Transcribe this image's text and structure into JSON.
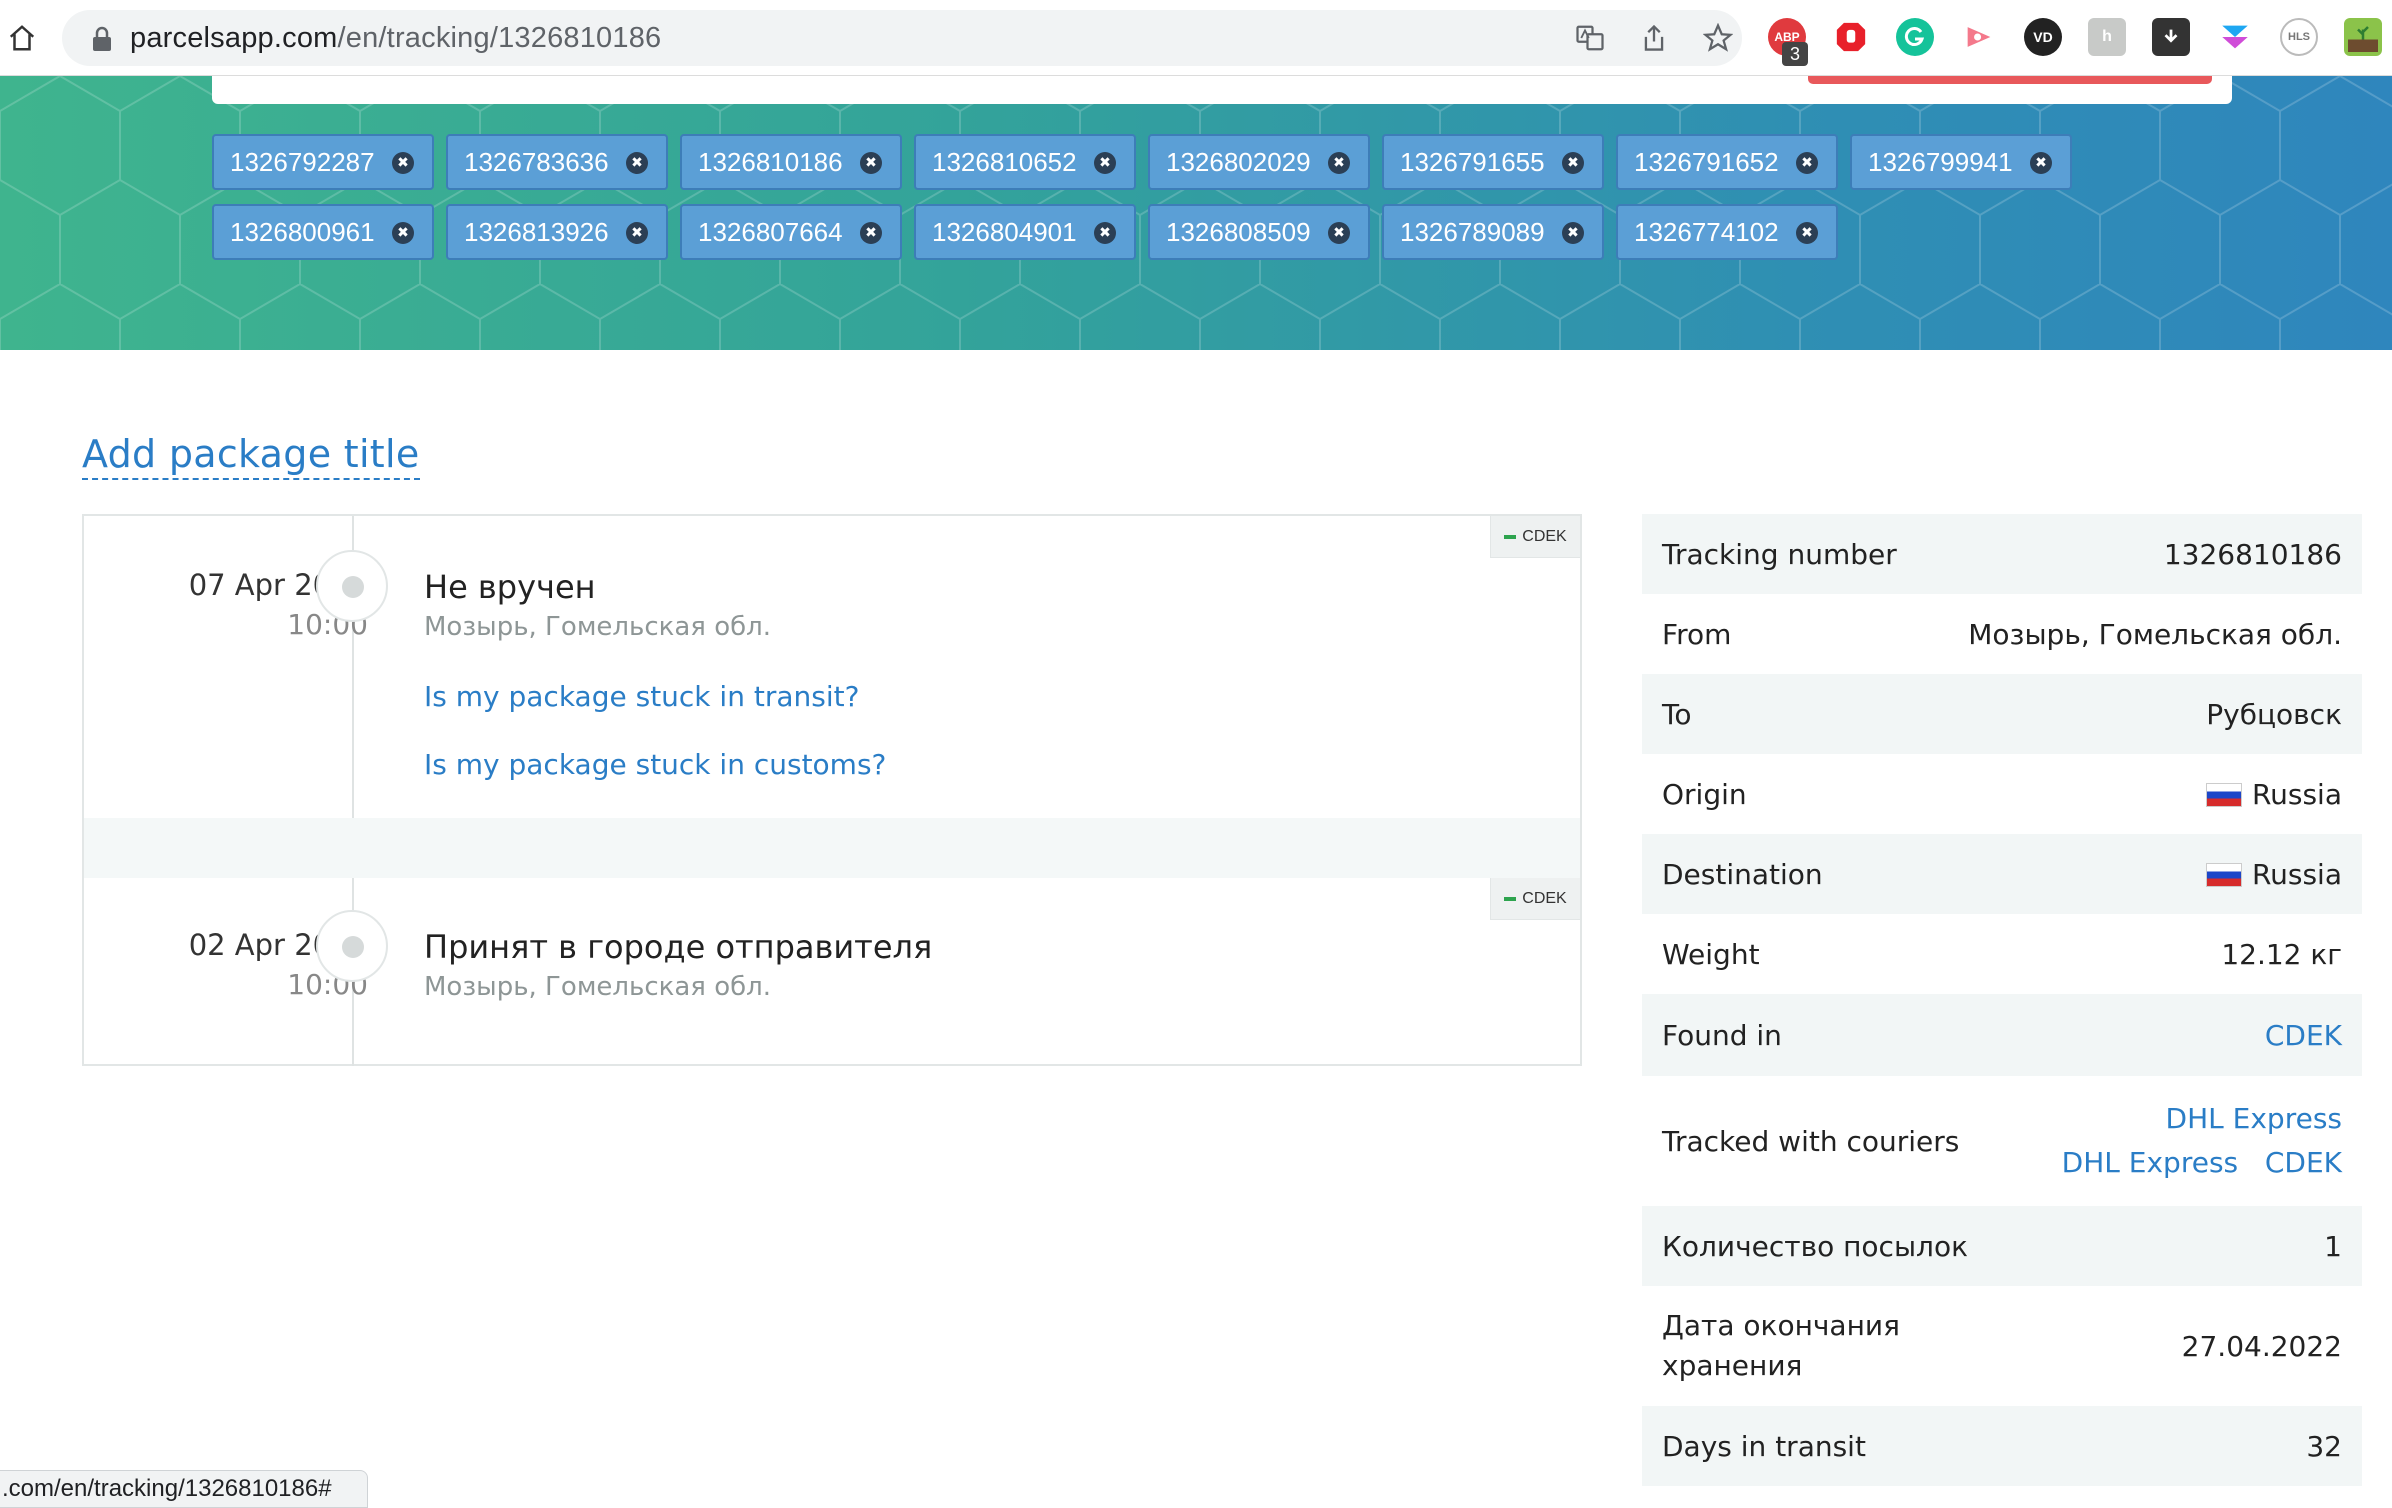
{
  "browser": {
    "url_host": "parcelsapp.com",
    "url_path": "/en/tracking/1326810186",
    "ext_badge": "3",
    "ext_abp_label": "ABP",
    "status_url": ".com/en/tracking/1326810186#"
  },
  "hero": {
    "chips": [
      "1326792287",
      "1326783636",
      "1326810186",
      "1326810652",
      "1326802029",
      "1326791655",
      "1326791652",
      "1326799941",
      "1326800961",
      "1326813926",
      "1326807664",
      "1326804901",
      "1326808509",
      "1326789089",
      "1326774102"
    ],
    "chip_remove": "✖"
  },
  "package": {
    "add_title": "Add package title"
  },
  "events": [
    {
      "date": "07 Apr 2022",
      "time": "10:00",
      "title": "Не вручен",
      "place": "Мозырь, Гомельская обл.",
      "courier": "CDEK",
      "links": [
        "Is my package stuck in transit?",
        "Is my package stuck in customs?"
      ]
    },
    {
      "date": "02 Apr 2022",
      "time": "10:00",
      "title": "Принят в городе отправителя",
      "place": "Мозырь, Гомельская обл.",
      "courier": "CDEK"
    }
  ],
  "info": {
    "tracking_number": {
      "label": "Tracking number",
      "value": "1326810186"
    },
    "from": {
      "label": "From",
      "value": "Мозырь, Гомельская обл."
    },
    "to": {
      "label": "To",
      "value": "Рубцовск"
    },
    "origin": {
      "label": "Origin",
      "value": "Russia"
    },
    "destination": {
      "label": "Destination",
      "value": "Russia"
    },
    "weight": {
      "label": "Weight",
      "value": "12.12 кг"
    },
    "found_in": {
      "label": "Found in",
      "value": "CDEK"
    },
    "tracked_with": {
      "label": "Tracked with couriers",
      "line1": [
        "DHL Express"
      ],
      "line2": [
        "DHL Express",
        "CDEK"
      ]
    },
    "parcel_count": {
      "label": "Количество посылок",
      "value": "1"
    },
    "storage_end": {
      "label_line1": "Дата окончания",
      "label_line2": "хранения",
      "value": "27.04.2022"
    },
    "days_in_transit": {
      "label": "Days in transit",
      "value": "32"
    }
  },
  "colors": {
    "link": "#2a7dc6",
    "chip_bg": "#5b9fd6",
    "hero_start": "#3fb48e",
    "hero_end": "#2f86bd"
  }
}
